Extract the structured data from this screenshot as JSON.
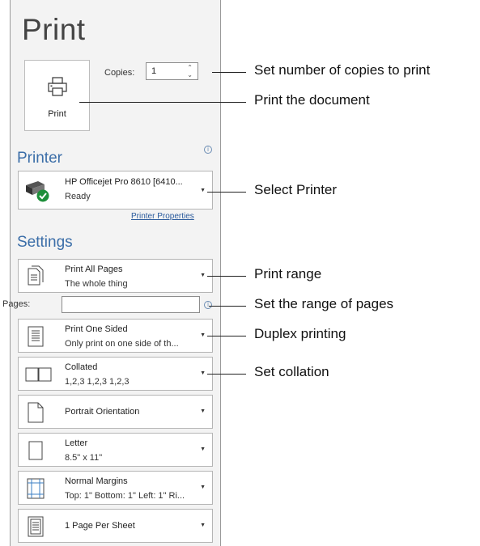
{
  "title": "Print",
  "print_button_label": "Print",
  "copies": {
    "label": "Copies:",
    "value": "1"
  },
  "printer": {
    "heading": "Printer",
    "name": "HP Officejet Pro 8610 [6410...",
    "status": "Ready",
    "properties_link": "Printer Properties"
  },
  "settings": {
    "heading": "Settings",
    "pages_label": "Pages:",
    "pages_value": "",
    "items": [
      {
        "line1": "Print All Pages",
        "line2": "The whole thing",
        "icon": "pages-icon"
      },
      {
        "line1": "Print One Sided",
        "line2": "Only print on one side of th...",
        "icon": "one-sided-icon"
      },
      {
        "line1": "Collated",
        "line2": "1,2,3   1,2,3   1,2,3",
        "icon": "collated-icon"
      },
      {
        "line1": "Portrait Orientation",
        "line2": "",
        "icon": "portrait-icon"
      },
      {
        "line1": "Letter",
        "line2": "8.5\" x 11\"",
        "icon": "paper-size-icon"
      },
      {
        "line1": "Normal Margins",
        "line2": "Top: 1\" Bottom: 1\" Left: 1\" Ri...",
        "icon": "margins-icon"
      },
      {
        "line1": "1 Page Per Sheet",
        "line2": "",
        "icon": "pages-per-sheet-icon"
      }
    ]
  },
  "callouts": [
    "Set number of copies to print",
    "Print the document",
    "Select Printer",
    "Print range",
    "Set the range of pages",
    "Duplex printing",
    "Set collation"
  ],
  "colors": {
    "accent": "#3b6ea8",
    "panel": "#f3f3f3",
    "status_ok": "#1e8f3a"
  }
}
